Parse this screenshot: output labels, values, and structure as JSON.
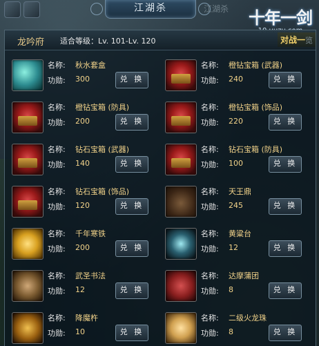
{
  "window": {
    "title": "江湖杀",
    "ghost_tab": "江湖杀",
    "logo_main": "十年一剑",
    "logo_url": "10.uuzu.com"
  },
  "header": {
    "location": "龙吟府",
    "level_label": "适合等级：",
    "level_range": "Lv. 101-Lv. 120",
    "switch_label": "对战一",
    "switch_suffix": "览"
  },
  "labels": {
    "name": "名称:",
    "merit": "功勋:",
    "exchange": "兑 换"
  },
  "items": [
    {
      "name": "秋水套盒",
      "merit": "300",
      "art": "box-icon"
    },
    {
      "name": "橙钻宝箱 (武器)",
      "merit": "240",
      "art": "chest-icon"
    },
    {
      "name": "橙钻宝箱 (防具)",
      "merit": "200",
      "art": "chest-icon"
    },
    {
      "name": "橙钻宝箱 (饰品)",
      "merit": "220",
      "art": "chest-icon"
    },
    {
      "name": "钻石宝箱 (武器)",
      "merit": "140",
      "art": "chest-icon"
    },
    {
      "name": "钻石宝箱 (防具)",
      "merit": "100",
      "art": "chest-icon"
    },
    {
      "name": "钻石宝箱 (饰品)",
      "merit": "120",
      "art": "chest-icon"
    },
    {
      "name": "天王鼎",
      "merit": "245",
      "art": "ding-icon"
    },
    {
      "name": "千年寒铁",
      "merit": "200",
      "art": "ingot-icon"
    },
    {
      "name": "黄粱台",
      "merit": "12",
      "art": "altar-icon"
    },
    {
      "name": "武圣书法",
      "merit": "12",
      "art": "scroll-icon"
    },
    {
      "name": "达摩蒲团",
      "merit": "8",
      "art": "cushion-icon"
    },
    {
      "name": "降魔杵",
      "merit": "10",
      "art": "pestle-icon"
    },
    {
      "name": "二级火龙珠",
      "merit": "8",
      "art": "pearl-icon"
    }
  ]
}
